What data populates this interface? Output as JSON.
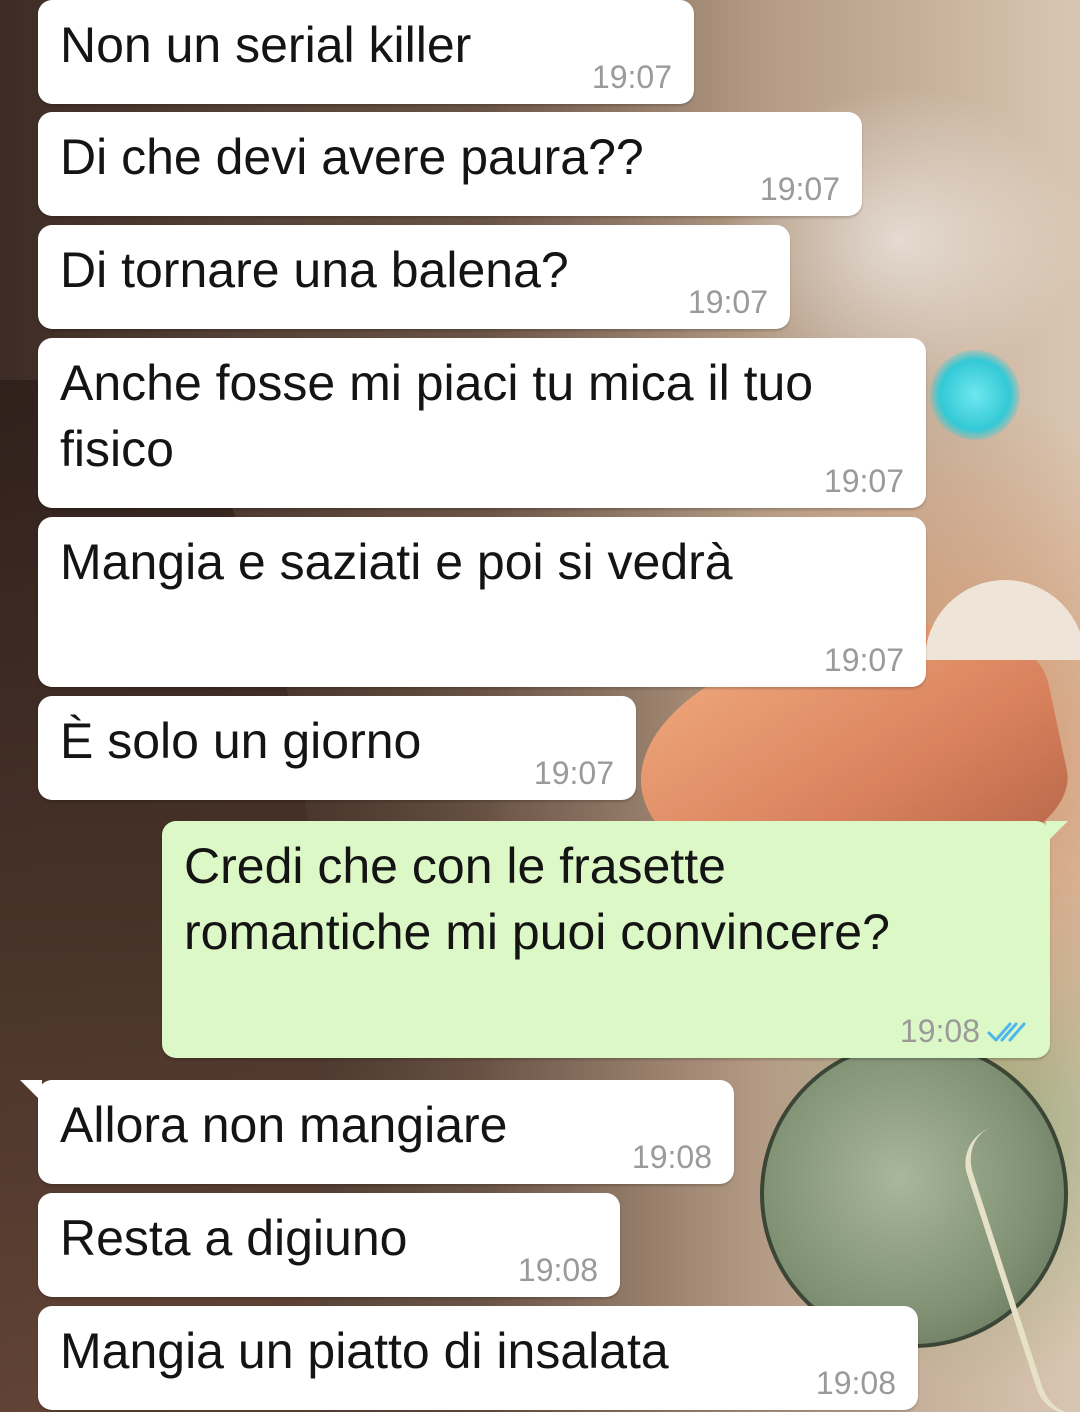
{
  "messages": [
    {
      "text": "Non un serial killer",
      "time": "19:07",
      "direction": "in"
    },
    {
      "text": "Di che devi avere paura??",
      "time": "19:07",
      "direction": "in"
    },
    {
      "text": "Di tornare una balena?",
      "time": "19:07",
      "direction": "in"
    },
    {
      "text": "Anche fosse mi piaci tu mica il tuo\nfisico",
      "time": "19:07",
      "direction": "in"
    },
    {
      "text": "Mangia e saziati e poi si vedrà",
      "time": "19:07",
      "direction": "in"
    },
    {
      "text": "È solo un giorno",
      "time": "19:07",
      "direction": "in"
    },
    {
      "text": "Credi che con le frasette\nromantiche mi puoi convincere?",
      "time": "19:08",
      "direction": "out",
      "status": "read"
    },
    {
      "text": "Allora non mangiare",
      "time": "19:08",
      "direction": "in"
    },
    {
      "text": "Resta a digiuno",
      "time": "19:08",
      "direction": "in"
    },
    {
      "text": "Mangia un piatto di insalata",
      "time": "19:08",
      "direction": "in"
    }
  ],
  "colors": {
    "incoming_bubble": "#ffffff",
    "outgoing_bubble": "#dcf8c6",
    "read_ticks": "#4fb6ec",
    "timestamp": "#9a9a9a"
  }
}
